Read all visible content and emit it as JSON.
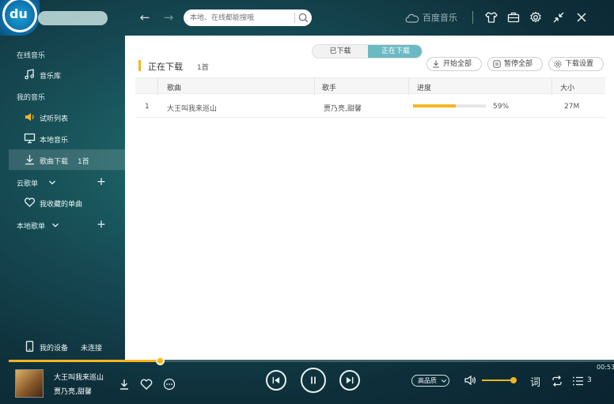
{
  "app": {
    "name": "百度音乐"
  },
  "search": {
    "placeholder": "本地、在线都能搜哦"
  },
  "sidebar": {
    "online_music": "在线音乐",
    "music_library": "音乐库",
    "my_music": "我的音乐",
    "trial_list": "试听列表",
    "local_music": "本地音乐",
    "song_download": "歌曲下载",
    "song_download_count": "1首",
    "cloud_playlist": "云歌单",
    "favorite_songs": "我收藏的单曲",
    "local_playlist": "本地歌单",
    "my_device": "我的设备",
    "device_status": "未连接"
  },
  "main": {
    "tabs": [
      {
        "label": "已下载"
      },
      {
        "label": "正在下载"
      }
    ],
    "title": "正在下载",
    "count": "1首",
    "start_all": "开始全部",
    "pause_all": "暂停全部",
    "download_settings": "下载设置",
    "columns": {
      "song": "歌曲",
      "artist": "歌手",
      "progress": "进度",
      "size": "大小"
    },
    "rows": [
      {
        "index": "1",
        "song": "大王叫我来巡山",
        "artist": "贾乃亮,甜馨",
        "progress": 0.59,
        "progress_text": "59%",
        "size": "27M"
      }
    ]
  },
  "player": {
    "song": "大王叫我来巡山",
    "artist": "贾乃亮,甜馨",
    "time": "00:53",
    "quality": "高品质",
    "lyric": "词",
    "queue_count": "3",
    "seek_progress": 0.25,
    "volume": 0.9
  },
  "colors": {
    "accent": "#f5b521",
    "tab_active": "#6bbac3"
  },
  "icons": [
    "back-arrow-icon",
    "forward-arrow-icon",
    "search-icon",
    "cloud-logo-icon",
    "skin-icon",
    "toolbox-icon",
    "gear-icon",
    "mini-mode-icon",
    "close-icon",
    "music-note-icon",
    "speaker-icon",
    "monitor-icon",
    "download-icon",
    "chevron-down-icon",
    "plus-icon",
    "heart-icon",
    "phone-icon",
    "more-icon",
    "prev-icon",
    "pause-icon",
    "next-icon",
    "volume-icon",
    "repeat-icon",
    "playlist-icon"
  ]
}
